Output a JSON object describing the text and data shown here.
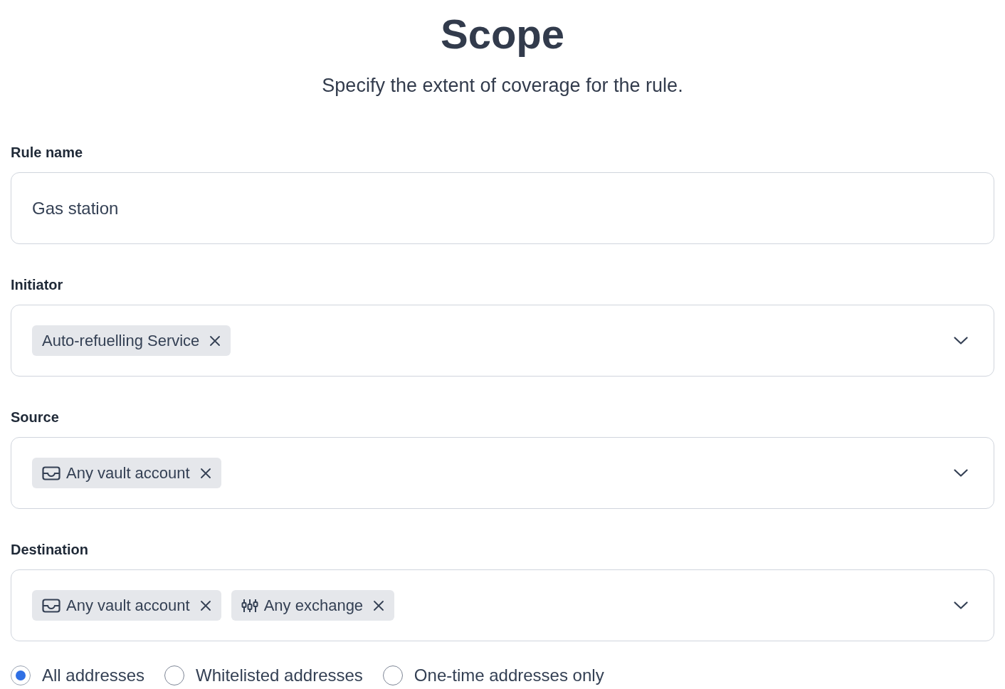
{
  "header": {
    "title": "Scope",
    "subtitle": "Specify the extent of coverage for the rule."
  },
  "fields": [
    {
      "kind": "text",
      "label": "Rule name",
      "value": "Gas station"
    },
    {
      "kind": "select",
      "label": "Initiator",
      "chips": [
        {
          "kind": "plain",
          "label": "Auto-refuelling Service"
        }
      ]
    },
    {
      "kind": "select",
      "label": "Source",
      "chips": [
        {
          "kind": "vault",
          "label": "Any vault account"
        }
      ]
    },
    {
      "kind": "select",
      "label": "Destination",
      "chips": [
        {
          "kind": "vault",
          "label": "Any vault account"
        },
        {
          "kind": "exchange",
          "label": "Any exchange"
        }
      ]
    }
  ],
  "address_options": [
    {
      "label": "All addresses",
      "selected": true
    },
    {
      "label": "Whitelisted addresses",
      "selected": false
    },
    {
      "label": "One-time addresses only",
      "selected": false
    }
  ]
}
